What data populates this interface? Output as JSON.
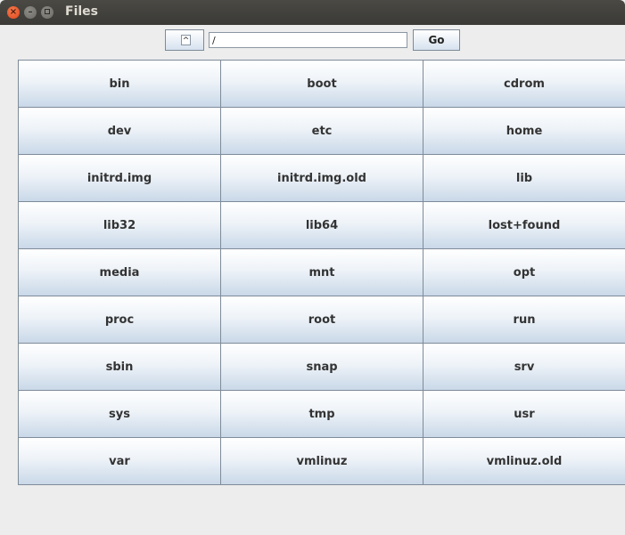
{
  "window": {
    "title": "Files",
    "close_glyph": "×",
    "minimize_glyph": "–"
  },
  "toolbar": {
    "up_glyph": "^",
    "path_value": "/",
    "go_label": "Go"
  },
  "files": [
    "bin",
    "boot",
    "cdrom",
    "dev",
    "etc",
    "home",
    "initrd.img",
    "initrd.img.old",
    "lib",
    "lib32",
    "lib64",
    "lost+found",
    "media",
    "mnt",
    "opt",
    "proc",
    "root",
    "run",
    "sbin",
    "snap",
    "srv",
    "sys",
    "tmp",
    "usr",
    "var",
    "vmlinuz",
    "vmlinuz.old"
  ],
  "colors": {
    "titlebar": "#3c3b37",
    "close_button": "#e95420",
    "window_background": "#ededed",
    "button_border": "#7e8b99"
  }
}
